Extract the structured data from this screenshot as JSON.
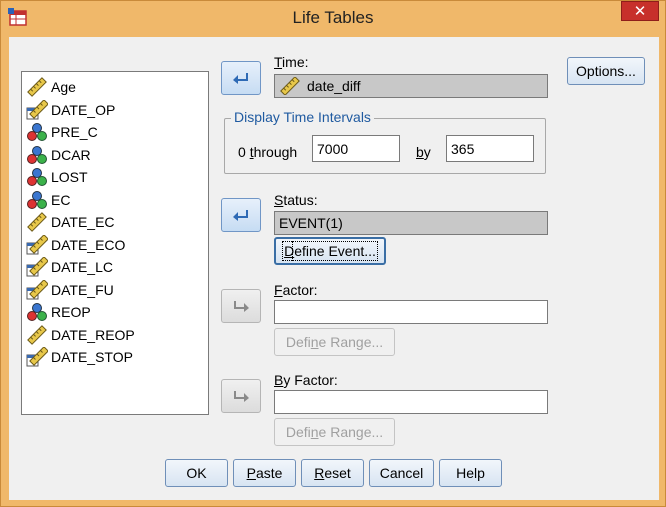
{
  "window": {
    "title": "Life Tables",
    "close_label": "✕"
  },
  "variables": [
    {
      "name": "Age",
      "icon": "ruler-icon"
    },
    {
      "name": "DATE_OP",
      "icon": "date-icon"
    },
    {
      "name": "PRE_C",
      "icon": "nominal-icon"
    },
    {
      "name": "DCAR",
      "icon": "nominal-icon"
    },
    {
      "name": "LOST",
      "icon": "nominal-icon"
    },
    {
      "name": "EC",
      "icon": "nominal-icon"
    },
    {
      "name": "DATE_EC",
      "icon": "ruler-icon"
    },
    {
      "name": "DATE_ECO",
      "icon": "date-icon"
    },
    {
      "name": "DATE_LC",
      "icon": "date-icon"
    },
    {
      "name": "DATE_FU",
      "icon": "date-icon"
    },
    {
      "name": "REOP",
      "icon": "nominal-icon"
    },
    {
      "name": "DATE_REOP",
      "icon": "ruler-icon"
    },
    {
      "name": "DATE_STOP",
      "icon": "date-icon"
    }
  ],
  "time": {
    "label_u": "T",
    "label_rest": "ime:",
    "value": "date_diff"
  },
  "intervals": {
    "title": "Display Time Intervals",
    "through_prefix": "0 ",
    "through_u": "t",
    "through_rest": "hrough",
    "through_value": "7000",
    "by_u": "b",
    "by_rest": "y",
    "by_value": "365"
  },
  "status": {
    "label_u": "S",
    "label_rest": "tatus:",
    "value": "EVENT(1)"
  },
  "define_event": {
    "label_u": "D",
    "label_rest": "efine Event..."
  },
  "factor": {
    "label_u": "F",
    "label_rest": "actor:",
    "value": ""
  },
  "define_range_1": {
    "pre": "Defi",
    "label_u": "n",
    "label_rest": "e Range..."
  },
  "by_factor": {
    "label_u": "B",
    "label_rest": "y Factor:",
    "value": ""
  },
  "define_range_2": {
    "pre": "Defi",
    "label_u": "n",
    "label_rest": "e Range..."
  },
  "buttons": {
    "ok": "OK",
    "paste_u": "P",
    "paste_rest": "aste",
    "reset_u": "R",
    "reset_rest": "eset",
    "cancel": "Cancel",
    "help": "Help",
    "options": "Options..."
  },
  "colors": {
    "title_bg": "#f0b86a",
    "close_red": "#c7302b",
    "group_title": "#1f5aa0"
  }
}
